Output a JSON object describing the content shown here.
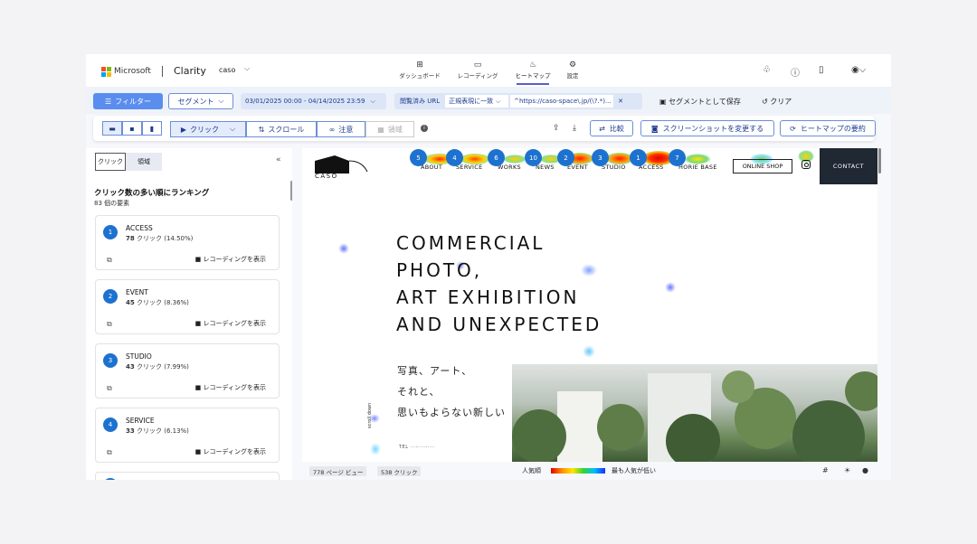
{
  "app": {
    "brand_ms": "Microsoft",
    "brand_clarity": "Clarity",
    "project": "caso",
    "colors": {
      "accent": "#5b5fc7",
      "primary": "#1d72cf",
      "filter_bg": "#5b8def"
    }
  },
  "nav": {
    "tabs": [
      {
        "label": "ダッシュボード",
        "icon": "dashboard-icon"
      },
      {
        "label": "レコーディング",
        "icon": "video-icon"
      },
      {
        "label": "ヒートマップ",
        "icon": "flame-icon"
      },
      {
        "label": "設定",
        "icon": "gear-icon"
      }
    ],
    "active_tab": "ヒートマップ"
  },
  "filters": {
    "filter_label": "フィルター",
    "segment_label": "セグメント",
    "date_range": "03/01/2025 00:00 - 04/14/2025 23:59",
    "url_label": "閲覧済み URL",
    "url_match": "正規表現に一致",
    "url_value": "^https://caso-space\\.jp/(\\?.*)...",
    "save_segment": "セグメントとして保存",
    "clear": "クリア"
  },
  "toolbar": {
    "modes": [
      {
        "label": "クリック",
        "icon": "pointer-icon"
      },
      {
        "label": "スクロール",
        "icon": "scroll-icon"
      },
      {
        "label": "注意",
        "icon": "glasses-icon"
      },
      {
        "label": "領域",
        "icon": "area-icon"
      }
    ],
    "compare": "比較",
    "change_screenshot": "スクリーンショットを変更する",
    "heatmap_summary": "ヒートマップの要約"
  },
  "sidebar": {
    "tab_click": "クリック",
    "tab_area": "領域",
    "title": "クリック数の多い順にランキング",
    "subtitle": "83 個の要素",
    "view_recordings": "レコーディングを表示",
    "items": [
      {
        "rank": "1",
        "name": "ACCESS",
        "clicks": "78",
        "unit": "クリック",
        "pct": "(14.50%)"
      },
      {
        "rank": "2",
        "name": "EVENT",
        "clicks": "45",
        "unit": "クリック",
        "pct": "(8.36%)"
      },
      {
        "rank": "3",
        "name": "STUDIO",
        "clicks": "43",
        "unit": "クリック",
        "pct": "(7.99%)"
      },
      {
        "rank": "4",
        "name": "SERVICE",
        "clicks": "33",
        "unit": "クリック",
        "pct": "(6.13%)"
      }
    ]
  },
  "site": {
    "logo_text": "CASO",
    "nav": [
      "ABOUT",
      "SERVICE",
      "WORKS",
      "NEWS",
      "EVENT",
      "STUDIO",
      "ACCESS",
      "HORIE BASE"
    ],
    "online_shop": "ONLINE SHOP",
    "contact": "CONTACT",
    "hero_lines": [
      "COMMERCIAL",
      "PHOTO,",
      "ART EXHIBITION",
      "AND UNEXPECTED"
    ],
    "jp_lines": [
      "写真、アート、",
      "それと、",
      "思いもよらない新しい"
    ],
    "scroll_down": "scroll down",
    "markers": [
      "5",
      "4",
      "6",
      "10",
      "2",
      "3",
      "1",
      "7"
    ]
  },
  "footer": {
    "page_views": "778 ページ ビュー",
    "clicks": "538 クリック",
    "legend_high": "人気順",
    "legend_low": "最も人気が低い"
  }
}
